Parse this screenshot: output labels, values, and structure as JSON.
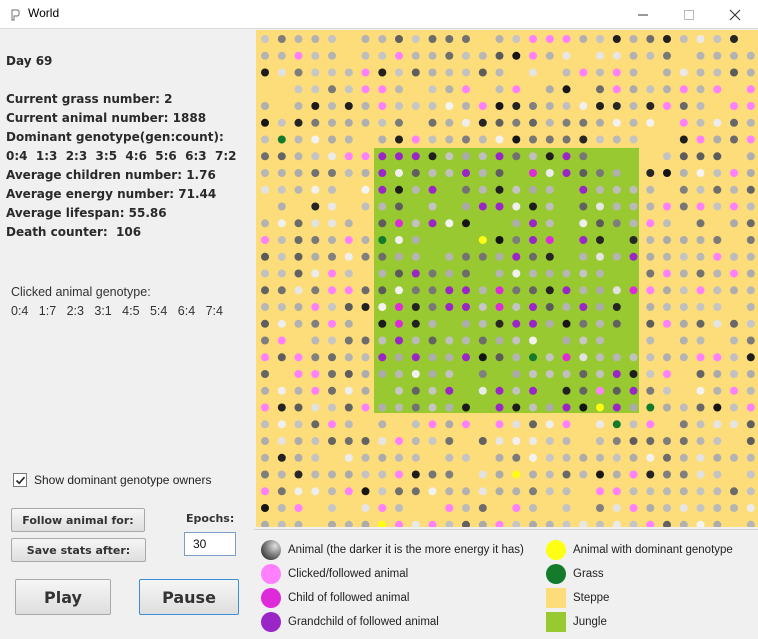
{
  "window": {
    "title": "World",
    "minimize_icon": "minimize-icon",
    "maximize_icon": "maximize-icon",
    "close_icon": "close-icon"
  },
  "stats": {
    "day": "Day 69",
    "grass": "Current grass number: 2",
    "animals": "Current animal number: 1888",
    "dominant_label": "Dominant genotype(gen:count):",
    "dominant_genes": "0:4  1:3  2:3  3:5  4:6  5:6  6:3  7:2",
    "avg_children": "Average children number: 1.76",
    "avg_energy": "Average energy number: 71.44",
    "avg_lifespan": "Average lifespan: 55.86",
    "deaths": "Death counter:  106"
  },
  "clicked": {
    "label": "Clicked animal genotype:",
    "genes": "0:4   1:7   2:3   3:1   4:5   5:4   6:4   7:4"
  },
  "controls": {
    "show_dominant_label": "Show dominant genotype owners",
    "show_dominant_checked": true,
    "follow_label": "Follow animal for:",
    "save_label": "Save stats after:",
    "epochs_label": "Epochs:",
    "epochs_value": "30",
    "play_label": "Play",
    "pause_label": "Pause"
  },
  "colors": {
    "steppe": "#fcdd7a",
    "jungle": "#99c930",
    "grass": "#147a2c",
    "dominant": "#ffff14",
    "clicked": "#ff80ff",
    "child": "#de2ad8",
    "grandchild": "#9a26c8",
    "animal_light": "#c8c8c8",
    "animal_dark": "#1e1e1e"
  },
  "legend": {
    "animal": "Animal (the darker it is the more energy it has)",
    "clicked": "Clicked/followed animal",
    "child": "Child of followed animal",
    "grandchild": "Grandchild of followed animal",
    "dominant": "Animal with dominant genotype",
    "grass": "Grass",
    "steppe": "Steppe",
    "jungle": "Jungle"
  }
}
